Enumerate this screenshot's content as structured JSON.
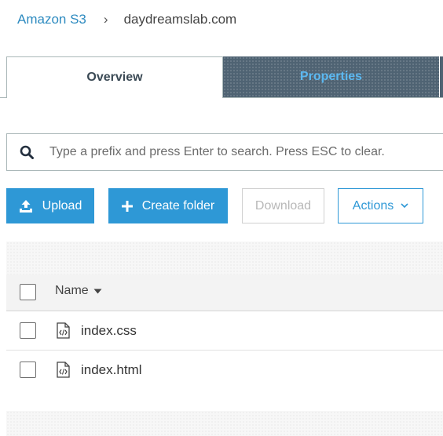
{
  "breadcrumb": {
    "root": "Amazon S3",
    "separator": "›",
    "current": "daydreamslab.com"
  },
  "tabs": [
    {
      "label": "Overview",
      "active": true
    },
    {
      "label": "Properties",
      "active": false
    }
  ],
  "search": {
    "placeholder": "Type a prefix and press Enter to search. Press ESC to clear.",
    "value": "",
    "icon": "search-icon"
  },
  "toolbar": {
    "upload_label": "Upload",
    "create_folder_label": "Create folder",
    "download_label": "Download",
    "actions_label": "Actions"
  },
  "table": {
    "columns": [
      {
        "label": "Name",
        "sort": "descending"
      }
    ],
    "rows": [
      {
        "name": "index.css",
        "icon": "code-file-icon",
        "checked": false
      },
      {
        "name": "index.html",
        "icon": "code-file-icon",
        "checked": false
      }
    ]
  },
  "colors": {
    "accent": "#2e98d6",
    "link": "#2e8bc0",
    "tab_inactive_bg": "#4f6373",
    "tab_inactive_text": "#5cb8f0",
    "disabled_text": "#b8b8b8"
  }
}
